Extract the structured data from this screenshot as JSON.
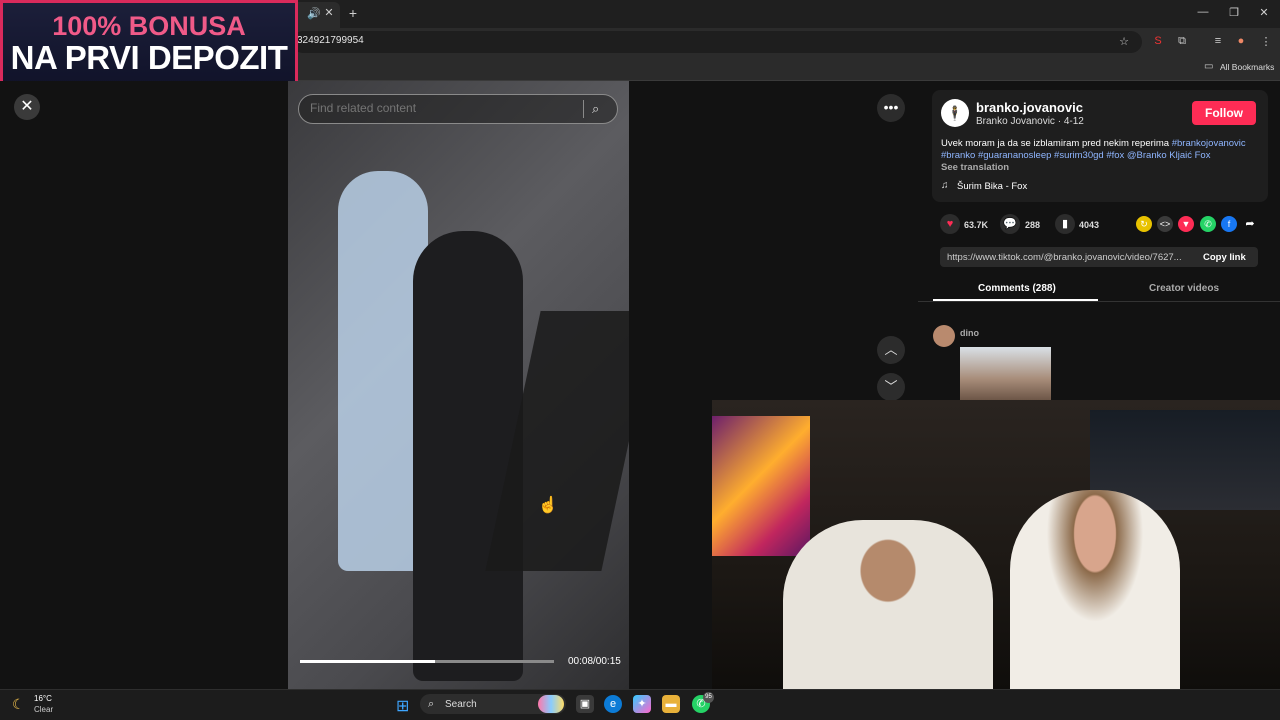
{
  "browser": {
    "url": "324921799954",
    "bookmarks_label": "All Bookmarks",
    "tab_audio_icon": "speaker-icon",
    "new_tab": "+",
    "window_controls": [
      "minimize-icon",
      "restore-icon",
      "close-icon"
    ]
  },
  "ad_banner": {
    "line1": "100% BONUSA",
    "line2": "NA PRVI DEPOZIT"
  },
  "video": {
    "search_placeholder": "Find related content",
    "time": "00:08/00:15",
    "progress": 0.533
  },
  "post": {
    "author_handle": "branko.jovanovic",
    "author_sub": "Branko Jovanovic · 4-12",
    "follow_label": "Follow",
    "caption_text": "Uvek moram ja da se izblamiram pred nekim reperima ",
    "caption_tags": "#brankojovanovic #branko #guarananosleep #surim30gd #fox @Branko Kljaić Fox",
    "see_translation": "See translation",
    "music": "Šurim Bika - Fox",
    "likes": "63.7K",
    "comments_count": "288",
    "saves": "4043",
    "link_url": "https://www.tiktok.com/@branko.jovanovic/video/7627...",
    "copy_link": "Copy link",
    "tabs": {
      "comments": "Comments (288)",
      "creator": "Creator videos"
    },
    "comment_user": "dino"
  },
  "taskbar": {
    "temp": "16°C",
    "condition": "Clear",
    "search": "Search",
    "badge": "95"
  },
  "colors": {
    "accent": "#fe2c55",
    "hashtag": "#8fb6ff",
    "ad_pink": "#f05a88"
  }
}
